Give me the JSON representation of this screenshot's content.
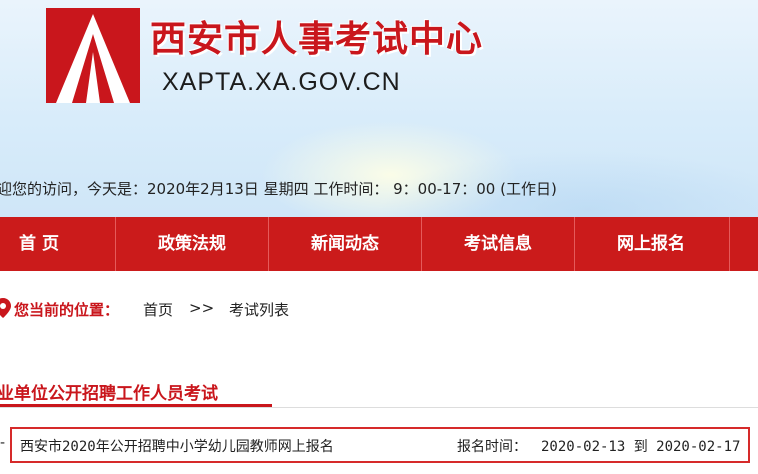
{
  "header": {
    "site_title": "西安市人事考试中心",
    "site_domain": "XAPTA.XA.GOV.CN",
    "welcome_text": "迎您的访问，今天是：2020年2月13日 星期四    工作时间：  9：00-17：00 (工作日)"
  },
  "nav": {
    "items": [
      {
        "label": "首  页"
      },
      {
        "label": "政策法规"
      },
      {
        "label": "新闻动态"
      },
      {
        "label": "考试信息"
      },
      {
        "label": "网上报名"
      }
    ]
  },
  "breadcrumb": {
    "label": "您当前的位置：",
    "home": "首页",
    "separator": ">>",
    "current": "考试列表"
  },
  "section": {
    "title": "业单位公开招聘工作人员考试"
  },
  "list": {
    "items": [
      {
        "dash": "-",
        "title": "西安市2020年公开招聘中小学幼儿园教师网上报名",
        "date_label": "报名时间：",
        "dates": "2020-02-13 到 2020-02-17"
      }
    ]
  },
  "colors": {
    "brand_red": "#c9161c",
    "nav_red": "#cb1b1b"
  }
}
